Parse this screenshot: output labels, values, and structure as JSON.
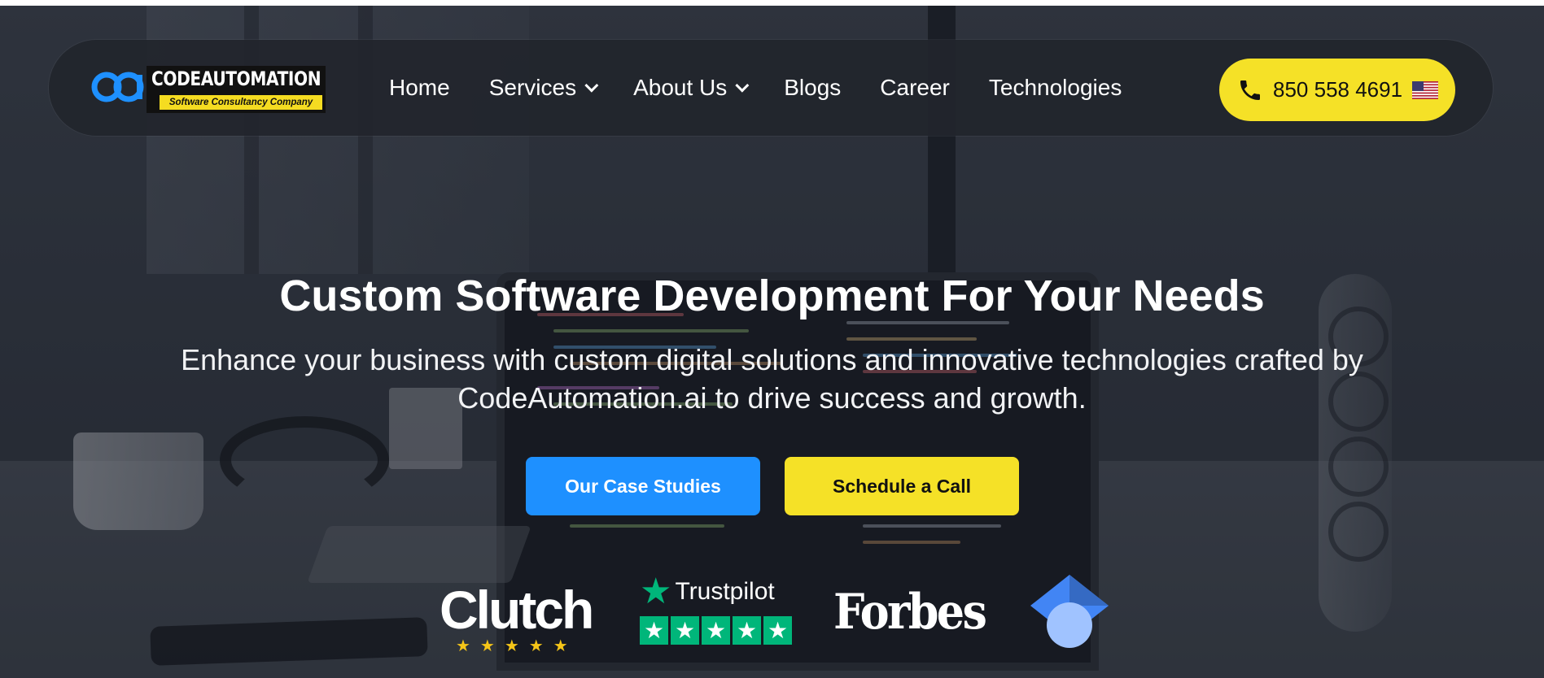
{
  "nav": {
    "logo": {
      "title": "CODEAUTOMATION",
      "tagline": "Software Consultancy Company"
    },
    "items": [
      {
        "label": "Home"
      },
      {
        "label": "Services"
      },
      {
        "label": "About Us"
      },
      {
        "label": "Blogs"
      },
      {
        "label": "Career"
      },
      {
        "label": "Technologies"
      }
    ],
    "phone": {
      "number": "850 558 4691",
      "icon": "phone-icon",
      "flag": "us-flag-icon"
    }
  },
  "hero": {
    "title": "Custom Software Development For Your Needs",
    "subtitle": "Enhance your business with custom digital solutions and innovative technologies crafted by CodeAutomation.ai to drive success and growth.",
    "primary_button": "Our Case Studies",
    "secondary_button": "Schedule a Call"
  },
  "badges": {
    "clutch": "Clutch",
    "trustpilot": "Trustpilot",
    "forbes": "Forbes"
  },
  "colors": {
    "accent_blue": "#1e90ff",
    "accent_yellow": "#f5e127",
    "nav_bg": "#22252c",
    "trustpilot_green": "#00b67a"
  }
}
